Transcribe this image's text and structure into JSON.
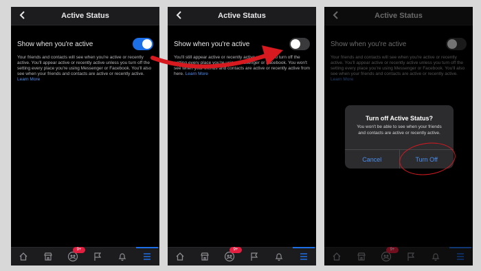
{
  "screens": [
    {
      "title": "Active Status",
      "setting_label": "Show when you're active",
      "toggle_on": true,
      "description": "Your friends and contacts will see when you're active or recently active. You'll appear active or recently active unless you turn off the setting every place you're using Messenger or Facebook. You'll also see when your friends and contacts are active or recently active.",
      "learn_more": "Learn More",
      "badge": "9+"
    },
    {
      "title": "Active Status",
      "setting_label": "Show when you're active",
      "toggle_on": false,
      "description": "You'll still appear active or recently active unless you turn off the setting every place you're using Messenger or Facebook. You won't see when your friends and contacts are active or recently active from here.",
      "learn_more": "Learn More",
      "badge": "9+"
    },
    {
      "title": "Active Status",
      "setting_label": "Show when you're active",
      "toggle_on": false,
      "description": "Your friends and contacts will see when you're active or recently active. You'll appear active or recently active unless you turn off the setting every place you're using Messenger or Facebook. You'll also see when your friends and contacts are active or recently active.",
      "learn_more": "Learn More",
      "badge": "9+"
    }
  ],
  "dialog": {
    "title": "Turn off Active Status?",
    "message": "You won't be able to see when your friends and contacts are active or recently active.",
    "cancel": "Cancel",
    "confirm": "Turn Off"
  },
  "colors": {
    "accent": "#1d6fe8",
    "annotation": "#d71920",
    "badge": "#e41e3f"
  },
  "icons": [
    "back-chevron-icon",
    "home-icon",
    "marketplace-icon",
    "groups-icon",
    "flag-icon",
    "bell-icon",
    "menu-icon"
  ]
}
